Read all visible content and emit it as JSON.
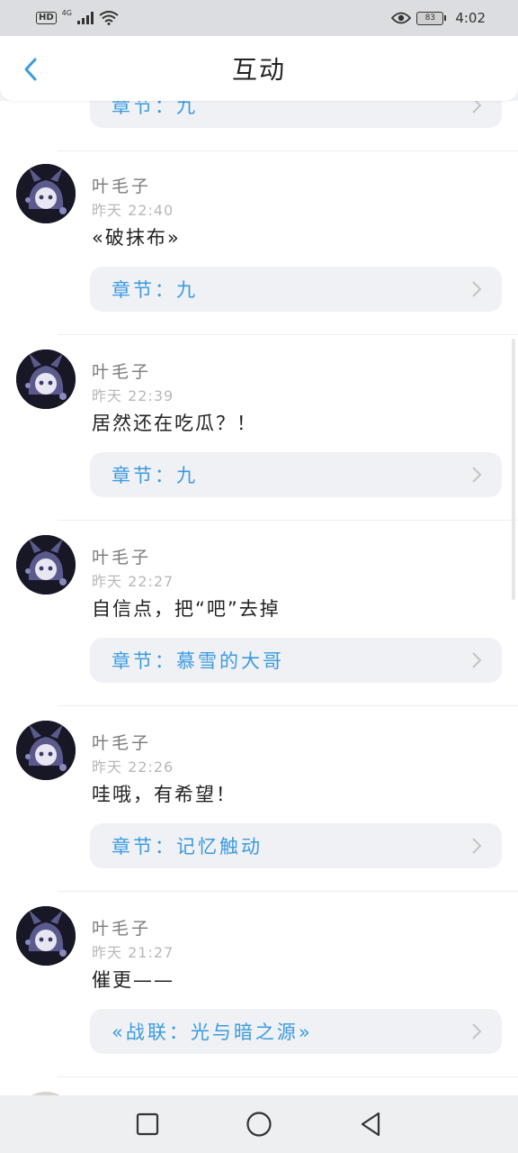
{
  "status_bar": {
    "hd": "HD",
    "network": "4G",
    "battery": "83",
    "time": "4:02",
    "icons": [
      "hd-icon",
      "signal-icon",
      "wifi-icon",
      "eye-icon",
      "battery-icon"
    ]
  },
  "header": {
    "title": "互动",
    "back_icon": "chevron-left-icon",
    "accent_color": "#3a9be0"
  },
  "feed": {
    "top_partial_chapter": "章节：九",
    "items": [
      {
        "name": "叶毛子",
        "time": "昨天 22:40",
        "message": "«破抹布»",
        "chapter": "章节：九"
      },
      {
        "name": "叶毛子",
        "time": "昨天 22:39",
        "message": "居然还在吃瓜？！",
        "chapter": "章节：九"
      },
      {
        "name": "叶毛子",
        "time": "昨天 22:27",
        "message": "自信点，把“吧”去掉",
        "chapter": "章节：慕雪的大哥"
      },
      {
        "name": "叶毛子",
        "time": "昨天 22:26",
        "message": "哇哦，有希望！",
        "chapter": "章节：记忆触动"
      },
      {
        "name": "叶毛子",
        "time": "昨天 21:27",
        "message": "催更——",
        "chapter": "«战联：光与暗之源»"
      }
    ]
  },
  "nav_bar": {
    "icons": [
      "square-recent-icon",
      "circle-home-icon",
      "triangle-back-icon"
    ]
  }
}
